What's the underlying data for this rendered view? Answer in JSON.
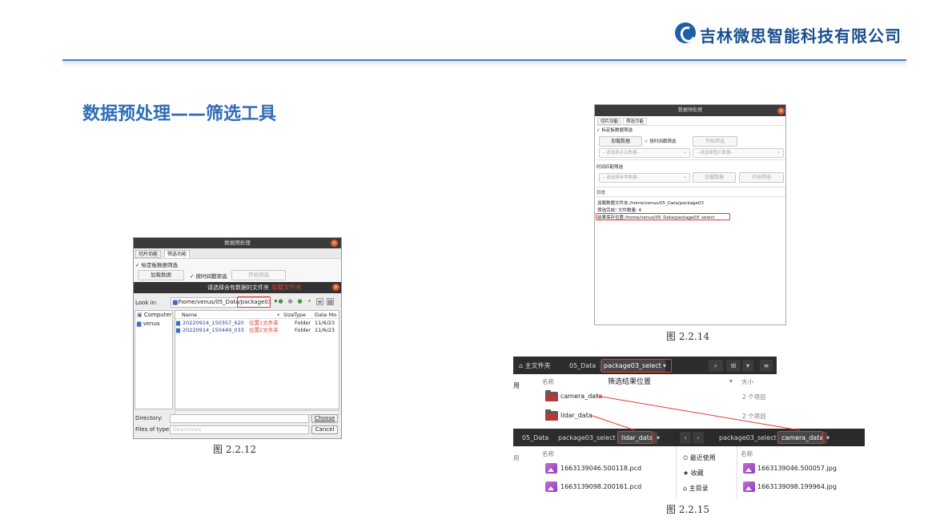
{
  "header": {
    "company": "吉林微思智能科技有限公司",
    "title": "数据预处理——筛选工具"
  },
  "captions": {
    "fig12": "图 2.2.12",
    "fig14": "图 2.2.14",
    "fig15": "图 2.2.15"
  },
  "fig12": {
    "window_title": "数据预处理",
    "tab_slice": "切片功能",
    "tab_filter": "筛选功能",
    "calib_check": "✓ 标定板数据筛选",
    "load_button": "加载数据",
    "time_check": "✓ 按时间戳筛选",
    "start_button": "开始筛选",
    "dialog_title": "请选择含有数据的文件夹",
    "annotation_load": "加载文件夹",
    "look_in": "Look in:",
    "path_prefix": "/home/venus/05_Data/",
    "path_highlight": "package03",
    "sidebar": [
      "Computer",
      "venus"
    ],
    "columns": {
      "name": "Name",
      "size": "Size",
      "type": "Type",
      "date": "Date Mo"
    },
    "rows": [
      {
        "name": "20220914_150357_620",
        "note": "位置1文件夹",
        "type": "Folder",
        "date": "11/6/23"
      },
      {
        "name": "20220914_150449_033",
        "note": "位置2文件夹",
        "type": "Folder",
        "date": "11/6/23"
      }
    ],
    "directory_label": "Directory:",
    "files_type_label": "Files of type:",
    "files_type_value": "Directories",
    "choose_button": "Choose",
    "cancel_button": "Cancel"
  },
  "fig14": {
    "window_title": "数据预处理",
    "tab_slice": "切片功能",
    "tab_filter": "筛选功能",
    "calib_check": "✓ 标定板数据筛选",
    "load_button": "加载数据",
    "time_check": "✓ 按时间戳筛选",
    "start_button": "开始筛选",
    "combo_pointcloud": "--请选择点云数据--",
    "combo_image": "--请选择图片数据--",
    "time_match_check": "时间匹配筛选",
    "combo_reference": "--请选择参考数据--",
    "load_button2": "加载数据",
    "start_button2": "开始筛选",
    "log_label": "日志",
    "log_lines": [
      "加载数据文件夹:/home/venus/05_Data/package03",
      "筛选完成! 文件数量: 4",
      "结果保存位置:/home/venus/05_Data/package03_select"
    ]
  },
  "fig15": {
    "top_crumbs": [
      "主文件夹",
      "05_Data",
      "package03_select"
    ],
    "annotation": "筛选结果位置",
    "col_name": "名称",
    "col_size": "大小",
    "side_partial": "用",
    "folders": [
      {
        "name": "camera_data",
        "size": "2 个项目"
      },
      {
        "name": "lidar_data",
        "size": "2 个项目"
      }
    ],
    "left_crumbs": [
      "05_Data",
      "package03_select",
      "lidar_data"
    ],
    "right_crumbs": [
      "package03_select",
      "camera_data"
    ],
    "places": [
      "最近使用",
      "收藏",
      "主目录"
    ],
    "lidar_files": [
      "1663139046.500118.pcd",
      "1663139098.200161.pcd"
    ],
    "camera_files": [
      "1663139046.500057.jpg",
      "1663139098.199964.jpg"
    ]
  }
}
